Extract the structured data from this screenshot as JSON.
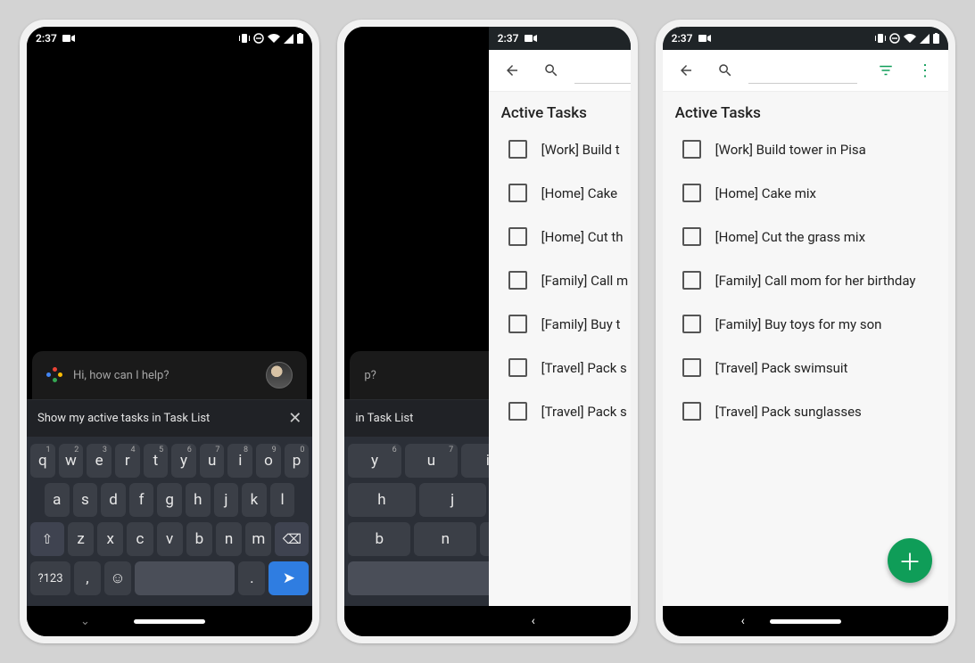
{
  "status": {
    "time": "2:37"
  },
  "assistant": {
    "greeting": "Hi, how can I help?",
    "suggestion": "Show my active tasks in Task List",
    "suggestion_partial": "in Task List",
    "greeting_partial": "p?"
  },
  "keyboard": {
    "row1": [
      {
        "k": "q",
        "n": "1"
      },
      {
        "k": "w",
        "n": "2"
      },
      {
        "k": "e",
        "n": "3"
      },
      {
        "k": "r",
        "n": "4"
      },
      {
        "k": "t",
        "n": "5"
      },
      {
        "k": "y",
        "n": "6"
      },
      {
        "k": "u",
        "n": "7"
      },
      {
        "k": "i",
        "n": "8"
      },
      {
        "k": "o",
        "n": "9"
      },
      {
        "k": "p",
        "n": "0"
      }
    ],
    "row2": [
      "a",
      "s",
      "d",
      "f",
      "g",
      "h",
      "j",
      "k",
      "l"
    ],
    "row3": [
      "z",
      "x",
      "c",
      "v",
      "b",
      "n",
      "m"
    ],
    "sym": "?123",
    "comma": ",",
    "period": "."
  },
  "todo": {
    "section": "Active Tasks",
    "tasks": [
      "[Work] Build tower in Pisa",
      "[Home] Cake mix",
      "[Home] Cut the grass mix",
      "[Family] Call mom for her birthday",
      "[Family] Buy toys for my son",
      "[Travel] Pack swimsuit",
      "[Travel] Pack sunglasses"
    ],
    "tasks_truncated": [
      "[Work] Build t",
      "[Home] Cake",
      "[Home] Cut th",
      "[Family] Call m",
      "[Family] Buy t",
      "[Travel] Pack s",
      "[Travel] Pack s"
    ]
  }
}
